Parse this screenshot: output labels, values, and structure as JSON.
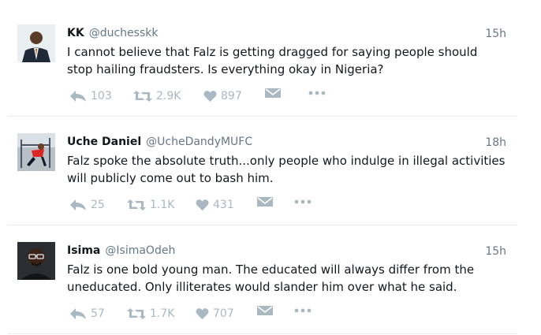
{
  "tweets": [
    {
      "name": "KK",
      "handle": "@duchesskk",
      "time": "15h",
      "text": "I cannot believe that Falz is getting dragged for saying people should stop hailing fraudsters. Is everything okay in Nigeria?",
      "replies": "103",
      "retweets": "2.9K",
      "likes": "897",
      "avatar": "man-in-suit-avatar"
    },
    {
      "name": "Uche Daniel",
      "handle": "@UcheDandyMUFC",
      "time": "18h",
      "text": "Falz spoke the absolute truth...only people who indulge in illegal activities will publicly come out to bash him.",
      "replies": "25",
      "retweets": "1.1K",
      "likes": "431",
      "avatar": "gym-avatar"
    },
    {
      "name": "Isima",
      "handle": "@IsimaOdeh",
      "time": "15h",
      "text": "Falz is one bold young man. The educated will always differ from the uneducated. Only illiterates would slander him over what he said.",
      "replies": "57",
      "retweets": "1.7K",
      "likes": "707",
      "avatar": "man-with-glasses-avatar"
    }
  ],
  "colors": {
    "icon": "#aab8c2",
    "handle": "#657786",
    "divider": "#e6ecf0"
  },
  "icons": [
    "reply-icon",
    "retweet-icon",
    "like-icon",
    "direct-message-icon",
    "more-icon"
  ]
}
